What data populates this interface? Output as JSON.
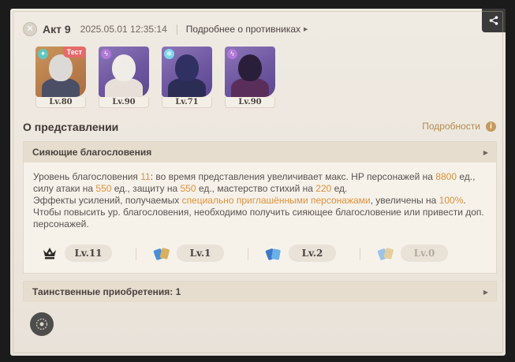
{
  "header": {
    "act_icon": "close-circle-icon",
    "act_title": "Акт 9",
    "datetime": "2025.05.01 12:35:14",
    "enemies_link": "Подробнее о противниках"
  },
  "share_icon": "share-icon",
  "characters": [
    {
      "level": "Lv.80",
      "element": "anemo",
      "badge": "Тест",
      "color": "gold"
    },
    {
      "level": "Lv.90",
      "element": "electro",
      "badge": "",
      "color": "purple"
    },
    {
      "level": "Lv.71",
      "element": "cryo",
      "badge": "",
      "color": "purple"
    },
    {
      "level": "Lv.90",
      "element": "electro",
      "badge": "",
      "color": "purple"
    }
  ],
  "performance": {
    "title": "О представлении",
    "details_label": "Подробности",
    "info_icon": "info-icon"
  },
  "blessing_panel": {
    "title": "Сияющие благословения",
    "desc": {
      "p1": "Уровень благословения ",
      "v_level": "11",
      "p2": ": во время представления увеличивает макс. HP персонажей на ",
      "v_hp": "8800",
      "p3": " ед., силу атаки на ",
      "v_atk": "550",
      "p4": " ед., защиту на ",
      "v_def": "550",
      "p5": " ед., мастерство стихий на ",
      "v_em": "220",
      "p6": " ед.",
      "p7": "Эффекты усилений, получаемых ",
      "v_invited": "специально приглашёнными персонажами",
      "p8": ", увеличены на ",
      "v_pct": "100%",
      "p9": ".",
      "p10": "Чтобы повысить ур. благословения, необходимо получить сияющее благословение или привести доп. персонажей."
    },
    "levels": [
      {
        "icon": "crown-icon",
        "value": "Lv.11",
        "dim": false
      },
      {
        "icon": "blue-gold-cards-icon",
        "value": "Lv.1",
        "dim": false
      },
      {
        "icon": "blue-cards-icon",
        "value": "Lv.2",
        "dim": false
      },
      {
        "icon": "faded-cards-icon",
        "value": "Lv.0",
        "dim": true
      }
    ]
  },
  "mystery_panel": {
    "title": "Таинственные приобретения: 1"
  },
  "bottom_button_icon": "round-emblem-icon",
  "colors": {
    "highlight": "#e0903a",
    "card_bg": "#efeae2",
    "panel_head": "#e6ddce",
    "details_link": "#b68a4a",
    "test_badge": "#e66a6a"
  }
}
